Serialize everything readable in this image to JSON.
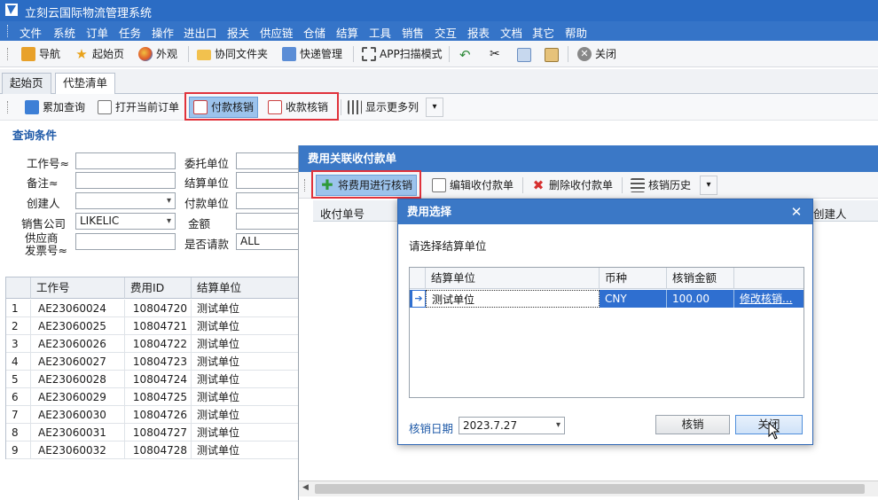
{
  "app": {
    "title": "立刻云国际物流管理系统"
  },
  "menu": [
    "文件",
    "系统",
    "订单",
    "任务",
    "操作",
    "进出口",
    "报关",
    "供应链",
    "仓储",
    "结算",
    "工具",
    "销售",
    "交互",
    "报表",
    "文档",
    "其它",
    "帮助"
  ],
  "toolbar": {
    "nav": "导航",
    "home": "起始页",
    "appearance": "外观",
    "shared_folder": "协同文件夹",
    "express": "快递管理",
    "app_scan": "APP扫描模式",
    "close": "关闭"
  },
  "tabs": {
    "start": "起始页",
    "active": "代垫清单"
  },
  "subtoolbar": {
    "accumulate_query": "累加查询",
    "open_order": "打开当前订单",
    "pay_writeoff": "付款核销",
    "receive_writeoff": "收款核销",
    "more_columns": "显示更多列"
  },
  "query": {
    "title": "查询条件",
    "job_no": "工作号≈",
    "remark": "备注≈",
    "creator": "创建人",
    "sales_company": "销售公司",
    "sales_company_value": "LIKELIC",
    "supplier_invoice": "供应商\n发票号≈",
    "client": "委托单位",
    "settle_unit": "结算单位",
    "pay_unit": "付款单位",
    "amount": "金额",
    "requested": "是否请款",
    "requested_value": "ALL"
  },
  "grid": {
    "headers": [
      "工作号",
      "费用ID",
      "结算单位"
    ],
    "rows": [
      {
        "n": "1",
        "job": "AE23060024",
        "id": "10804720",
        "unit": "测试单位"
      },
      {
        "n": "2",
        "job": "AE23060025",
        "id": "10804721",
        "unit": "测试单位"
      },
      {
        "n": "3",
        "job": "AE23060026",
        "id": "10804722",
        "unit": "测试单位"
      },
      {
        "n": "4",
        "job": "AE23060027",
        "id": "10804723",
        "unit": "测试单位"
      },
      {
        "n": "5",
        "job": "AE23060028",
        "id": "10804724",
        "unit": "测试单位"
      },
      {
        "n": "6",
        "job": "AE23060029",
        "id": "10804725",
        "unit": "测试单位"
      },
      {
        "n": "7",
        "job": "AE23060030",
        "id": "10804726",
        "unit": "测试单位"
      },
      {
        "n": "8",
        "job": "AE23060031",
        "id": "10804727",
        "unit": "测试单位"
      },
      {
        "n": "9",
        "job": "AE23060032",
        "id": "10804728",
        "unit": "测试单位"
      }
    ]
  },
  "panel": {
    "title": "费用关联收付款单",
    "btn_writeoff": "将费用进行核销",
    "btn_edit": "编辑收付款单",
    "btn_delete": "删除收付款单",
    "btn_history": "核销历史",
    "col_receipt_no": "收付单号",
    "col_creator": "创建人"
  },
  "dialog": {
    "title": "费用选择",
    "prompt": "请选择结算单位",
    "headers": [
      "结算单位",
      "币种",
      "核销金额"
    ],
    "row": {
      "unit": "测试单位",
      "currency": "CNY",
      "amount": "100.00",
      "link": "修改核销..."
    },
    "date_label": "核销日期",
    "date_value": "2023.7.27",
    "btn_ok": "核销",
    "btn_close": "关闭"
  }
}
